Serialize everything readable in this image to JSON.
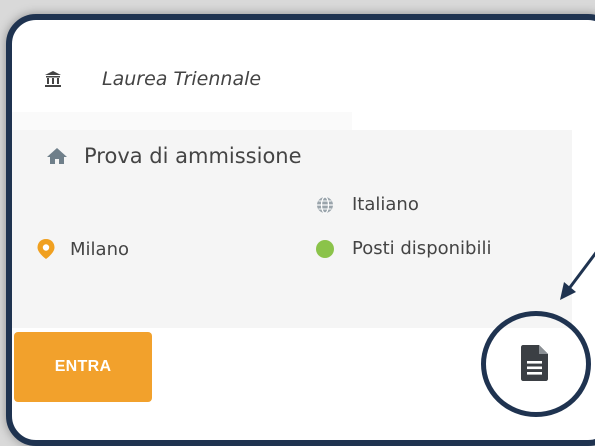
{
  "course": {
    "degree_label": "Laurea  Triennale",
    "degree_icon": "university-icon",
    "exam_label": "Prova di ammissione",
    "exam_icon": "home-icon",
    "language_label": "Italiano",
    "language_icon": "globe-icon",
    "city_label": "Milano",
    "city_icon": "map-marker-icon",
    "availability_label": "Posti disponibili",
    "availability_color": "#8bc34a"
  },
  "actions": {
    "enter_label": "ENTRA",
    "enter_color": "#f2a12c",
    "document_icon": "document-icon"
  },
  "colors": {
    "frame": "#1f3350",
    "icon_gray": "#555555",
    "marker_orange": "#f0a020"
  }
}
